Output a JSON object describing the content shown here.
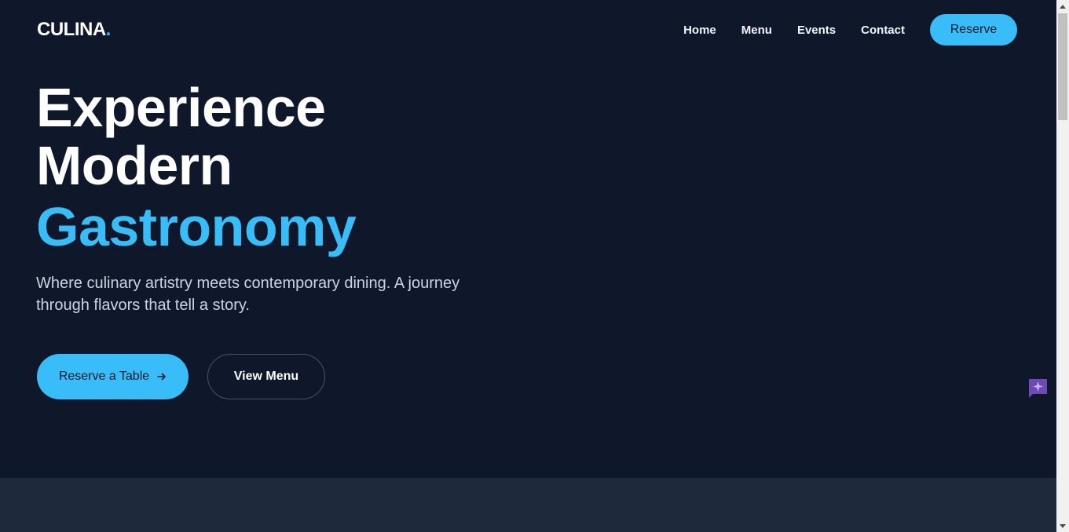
{
  "header": {
    "logo_text": "CULINA",
    "logo_dot": ".",
    "nav": [
      "Home",
      "Menu",
      "Events",
      "Contact"
    ],
    "reserve_label": "Reserve"
  },
  "hero": {
    "title_line1": "Experience",
    "title_line2": "Modern",
    "title_accent": "Gastronomy",
    "subtitle": "Where culinary artistry meets contemporary dining. A journey through flavors that tell a story.",
    "primary_button": "Reserve a Table",
    "primary_button_icon": "arrow-right-icon",
    "secondary_button": "View Menu"
  },
  "widgets": {
    "chat_icon": "chat-sparkle-icon"
  },
  "colors": {
    "background": "#0f172a",
    "accent": "#38bdf8",
    "section_alt": "#1e293b",
    "chat_widget": "#6d4bb3"
  }
}
